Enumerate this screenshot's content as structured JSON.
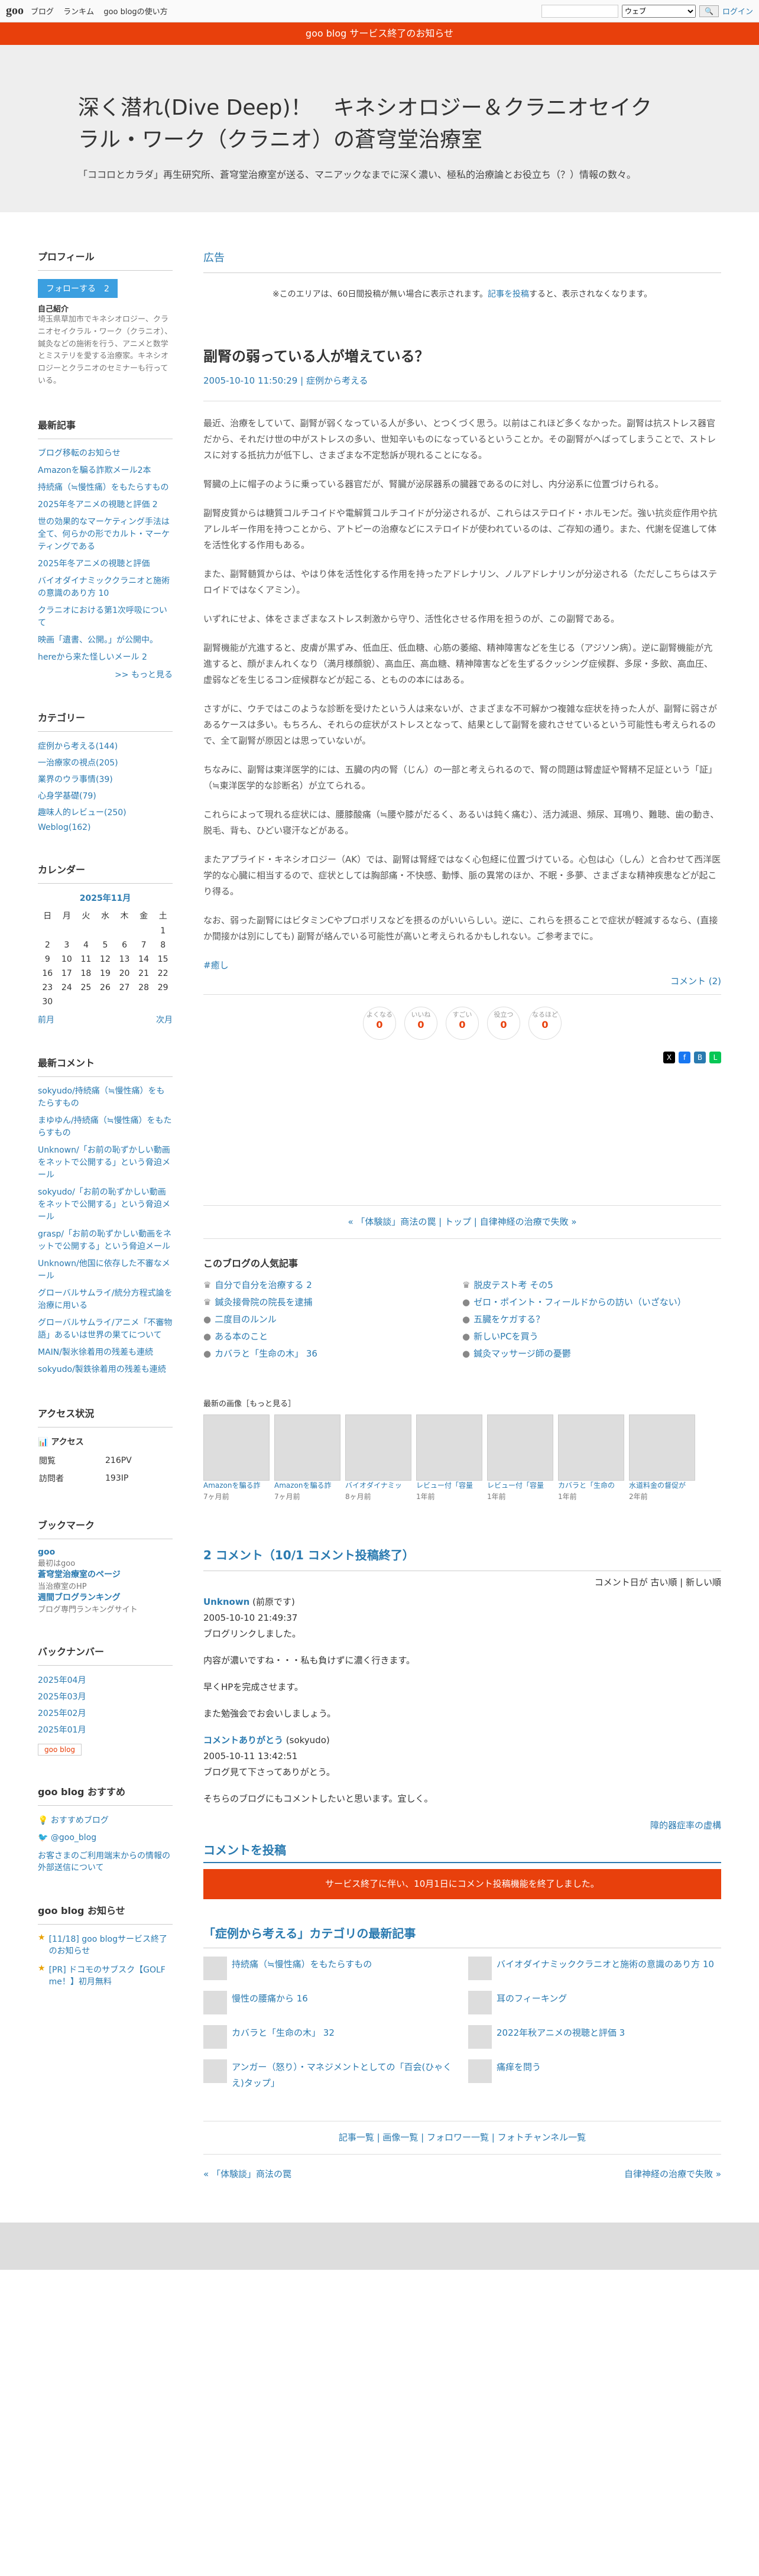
{
  "topbar": {
    "logo": "goo",
    "links": [
      "ブログ",
      "ランキム",
      "goo blogの使い方"
    ],
    "search_scope": "ウェブ",
    "login": "ログイン"
  },
  "notice": "goo blog サービス終了のお知らせ",
  "header": {
    "title": "深く潜れ(Dive Deep)！　キネシオロジー＆クラニオセイクラル・ワーク（クラニオ）の蒼穹堂治療室",
    "desc": "「ココロとカラダ」再生研究所、蒼穹堂治療室が送る、マニアックなまでに深く濃い、極私的治療論とお役立ち（？）情報の数々。"
  },
  "side": {
    "profile_h": "プロフィール",
    "follow": "フォローする　2",
    "author": "自己紹介",
    "intro": "埼玉県草加市でキネシオロジー、クラニオセイクラル・ワーク（クラニオ）、鍼灸などの施術を行う、アニメと数学とミステリを愛する治療家。キネシオロジーとクラニオのセミナーも行っている。",
    "recent_h": "最新記事",
    "recent": [
      "ブログ移転のお知らせ",
      "Amazonを騙る詐欺メール2本",
      "持続痛（≒慢性痛）をもたらすもの",
      "2025年冬アニメの視聴と評価 2",
      "世の効果的なマーケティング手法は全て、何らかの形でカルト・マーケティングである",
      "2025年冬アニメの視聴と評価",
      "バイオダイナミッククラニオと施術の意識のあり方 10",
      "クラニオにおける第1次呼吸について",
      "映画「遺書、公開。」が公開中。",
      "hereから来た怪しいメール 2"
    ],
    "more": ">> もっと見る",
    "cat_h": "カテゴリー",
    "cats": [
      "症例から考える(144)",
      "一治療家の視点(205)",
      "業界のウラ事情(39)",
      "心身学基礎(79)",
      "趣味人的レビュー(250)",
      "Weblog(162)"
    ],
    "cal_h": "カレンダー",
    "cal_title": "2025年11月",
    "cal_days": [
      "日",
      "月",
      "火",
      "水",
      "木",
      "金",
      "土"
    ],
    "cal_rows": [
      [
        "",
        "",
        "",
        "",
        "",
        "",
        "1"
      ],
      [
        "2",
        "3",
        "4",
        "5",
        "6",
        "7",
        "8"
      ],
      [
        "9",
        "10",
        "11",
        "12",
        "13",
        "14",
        "15"
      ],
      [
        "16",
        "17",
        "18",
        "19",
        "20",
        "21",
        "22"
      ],
      [
        "23",
        "24",
        "25",
        "26",
        "27",
        "28",
        "29"
      ],
      [
        "30",
        "",
        "",
        "",
        "",
        "",
        ""
      ]
    ],
    "cal_prev": "前月",
    "cal_next": "次月",
    "comments_h": "最新コメント",
    "comments": [
      "sokyudo/持続痛（≒慢性痛）をもたらすもの",
      "まゆゆん/持続痛（≒慢性痛）をもたらすもの",
      "Unknown/「お前の恥ずかしい動画をネットで公開する」という脅迫メール",
      "sokyudo/「お前の恥ずかしい動画をネットで公開する」という脅迫メール",
      "grasp/「お前の恥ずかしい動画をネットで公開する」という脅迫メール",
      "Unknown/他国に依存した不審なメール",
      "グローバルサムライ/統分方程式論を治療に用いる",
      "グローバルサムライ/アニメ「不審物語」あるいは世界の果てについて",
      "MAIN/製氷徐着用の残差も連続",
      "sokyudo/製鉄徐着用の残差も連続"
    ],
    "access_h": "アクセス状況",
    "access_sub": "アクセス",
    "access": [
      [
        "閲覧",
        "216PV"
      ],
      [
        "訪問者",
        "193IP"
      ]
    ],
    "bookmark_h": "ブックマーク",
    "bookmarks": [
      "goo",
      "最初はgoo",
      "蒼穹堂治療室のページ",
      "当治療室のHP",
      "週間ブログランキング",
      "ブログ専門ランキングサイト"
    ],
    "backnum_h": "バックナンバー",
    "backnum": [
      "2025年04月",
      "2025年03月",
      "2025年02月",
      "2025年01月"
    ],
    "badge": "goo blog",
    "recommend_h": "goo blog おすすめ",
    "recommend": [
      "おすすめブログ",
      "@goo_blog",
      "お客さまのご利用端末からの情報の外部送信について"
    ],
    "news_h": "goo blog お知らせ",
    "news": [
      "[11/18] goo blogサービス終了のお知らせ",
      "[PR] ドコモのサブスク【GOLF me！】初月無料"
    ]
  },
  "main": {
    "ad_h": "広告",
    "ad_note_a": "※このエリアは、60日間投稿が無い場合に表示されます。",
    "ad_note_link": "記事を投稿",
    "ad_note_b": "すると、表示されなくなります。",
    "title": "副腎の弱っている人が増えている？",
    "date": "2005-10-10 11:50:29",
    "sep": "|",
    "category": "症例から考える",
    "paras": [
      "最近、治療をしていて、副腎が弱くなっている人が多い、とつくづく思う。以前はこれほど多くなかった。副腎は抗ストレス器官だから、それだけ世の中がストレスの多い、世知辛いものになっているということか。その副腎がへばってしまうことで、ストレスに対する抵抗力が低下し、さまざまな不定愁訴が現れることになる。",
      "腎臓の上に帽子のように乗っている器官だが、腎臓が泌尿器系の臓器であるのに対し、内分泌系に位置づけられる。",
      "副腎皮質からは糖質コルチコイドや電解質コルチコイドが分泌されるが、これらはステロイド・ホルモンだ。強い抗炎症作用や抗アレルギー作用を持つことから、アトピーの治療などにステロイドが使われているのは、ご存知の通り。また、代謝を促進して体を活性化する作用もある。",
      "また、副腎髄質からは、やはり体を活性化する作用を持ったアドレナリン、ノルアドレナリンが分泌される（ただしこちらはステロイドではなくアミン）。",
      "いずれにせよ、体をさまざまなストレス刺激から守り、活性化させる作用を担うのが、この副腎である。",
      "副腎機能が亢進すると、皮膚が黒ずみ、低血圧、低血糖、心筋の萎縮、精神障害などを生じる（アジソン病）。逆に副腎機能が亢進すると、顔がまんれくなり（満月様顔貌）、高血圧、高血糖、精神障害などを生ずるクッシング症候群、多尿・多飲、高血圧、虚弱などを生じるコン症候群などが起こる、とものの本にはある。",
      "さすがに、ウチではこのような診断を受けたという人は来ないが、さまざまな不可解かつ複雑な症状を持った人が、副腎に弱さがあるケースは多い。もちろん、それらの症状がストレスとなって、結果として副腎を疲れさせているという可能性も考えられるので、全て副腎が原因とは思っていないが。",
      "ちなみに、副腎は東洋医学的には、五臓の内の腎（じん）の一部と考えられるので、腎の問題は腎虚証や腎精不足証という「証」（≒東洋医学的な診断名）が立てられる。",
      "これらによって現れる症状には、腰膝酸痛（≒腰や膝がだるく、あるいは鈍く痛む）、活力減退、頻尿、耳鳴り、難聴、歯の動き、脱毛、背も、ひどい寝汗などがある。",
      "またアプライド・キネシオロジー（AK）では、副腎は腎経ではなく心包経に位置づけている。心包は心（しん）と合わせて西洋医学的な心臓に相当するので、症状としては胸部痛・不快感、動悸、脈の異常のほか、不眠・多夢、さまざまな精神疾患などが起こり得る。",
      "なお、弱った副腎にはビタミンCやプロポリスなどを摂るのがいいらしい。逆に、これらを摂ることで症状が軽減するなら、(直接か間接かは別にしても) 副腎が絡んでいる可能性が高いと考えられるかもしれない。ご参考までに。"
    ],
    "tag": "#癒し",
    "comment_link": "コメント (2)",
    "reactions": [
      [
        "よくなる",
        "0"
      ],
      [
        "いいね",
        "0"
      ],
      [
        "すごい",
        "0"
      ],
      [
        "役立つ",
        "0"
      ],
      [
        "なるほど",
        "0"
      ]
    ],
    "prev_post": "« 「体験談」商法の罠",
    "pager_mid": " | トップ | ",
    "next_post": "自律神経の治療で失敗 »",
    "pop_h": "このブログの人気記事",
    "pop": [
      "自分で自分を治療する 2",
      "脱皮テスト考 その5",
      "鍼灸接骨院の院長を逮捕",
      "ゼロ・ポイント・フィールドからの訪い（いざない）",
      "二度目のルンル",
      "五臓をケガする？",
      "ある本のこと",
      "新しいPCを買う",
      "カバラと「生命の木」 36",
      "鍼灸マッサージ師の憂鬱"
    ],
    "imgs_h": "最新の画像［もっと見る］",
    "imgs": [
      [
        "Amazonを騙る詐",
        "7ヶ月前"
      ],
      [
        "Amazonを騙る詐",
        "7ヶ月前"
      ],
      [
        "バイオダイナミッ",
        "8ヶ月前"
      ],
      [
        "レビュー付「容量",
        "1年前"
      ],
      [
        "レビュー付「容量",
        "1年前"
      ],
      [
        "カバラと「生命の",
        "1年前"
      ],
      [
        "水道料金の督促が",
        "2年前"
      ]
    ],
    "comments_h": "2 コメント（10/1 コメント投稿終了）",
    "order": "コメント日が 古い順 | 新しい順",
    "c1_name": "Unknown",
    "c1_from": "(前原です)",
    "c1_date": "2005-10-10 21:49:37",
    "c1_lines": [
      "ブログリンクしました。",
      "内容が濃いですね・・・私も負けずに濃く行きます。",
      "早くHPを完成させます。",
      "また勉強会でお会いしましょう。"
    ],
    "c2_name": "コメントありがとう",
    "c2_from": "(sokyudo)",
    "c2_date": "2005-10-11 13:42:51",
    "c2_lines": [
      "ブログ見て下さってありがとう。",
      "そちらのブログにもコメントしたいと思います。宜しく。"
    ],
    "next_link": "障的器症率の虚構",
    "post_cm_h": "コメントを投稿",
    "cm_closed": "サービス終了に伴い、10月1日にコメント投稿機能を終了しました。",
    "cat_h": "「症例から考える」カテゴリの最新記事",
    "cat_posts": [
      "持続痛（≒慢性痛）をもたらすもの",
      "バイオダイナミッククラニオと施術の意識のあり方 10",
      "慢性の腰痛から 16",
      "耳のフィーキング",
      "カバラと「生命の木」 32",
      "2022年秋アニメの視聴と評価 3",
      "アンガー（怒り）・マネジメントとしての「百会(ひゃくえ)タップ」",
      "痛痒を問う"
    ],
    "foot_links": "記事一覧 | 画像一覧 | フォロワー一覧 | フォトチャンネル一覧",
    "bottom_prev": "« 「体験談」商法の罠",
    "bottom_next": "自律神経の治療で失敗 »"
  }
}
